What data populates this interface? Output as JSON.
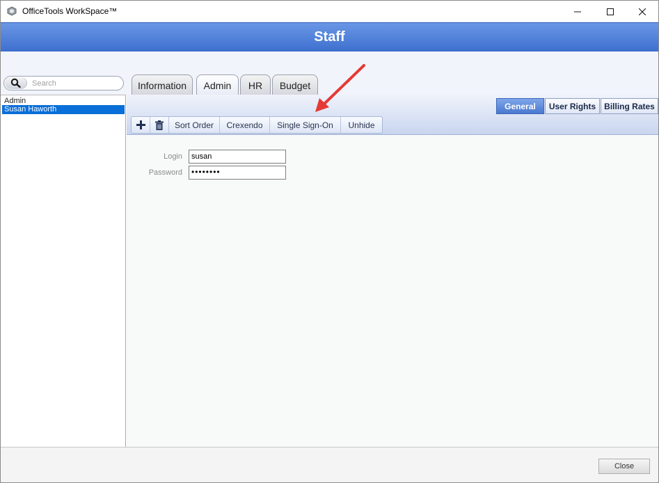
{
  "window": {
    "title": "OfficeTools WorkSpace™"
  },
  "header": {
    "title": "Staff"
  },
  "search": {
    "placeholder": "Search"
  },
  "staff_list": {
    "items": [
      "Admin",
      "Susan  Haworth"
    ],
    "selected": "Susan  Haworth"
  },
  "tabs": [
    {
      "label": "Information",
      "active": false
    },
    {
      "label": "Admin",
      "active": true
    },
    {
      "label": "HR",
      "active": false
    },
    {
      "label": "Budget",
      "active": false
    }
  ],
  "subtabs": [
    {
      "label": "General",
      "active": true
    },
    {
      "label": "User Rights",
      "active": false
    },
    {
      "label": "Billing Rates",
      "active": false
    }
  ],
  "toolbar": {
    "add_icon": "plus-icon",
    "delete_icon": "trash-icon",
    "buttons": [
      "Sort Order",
      "Crexendo",
      "Single Sign-On",
      "Unhide"
    ]
  },
  "form": {
    "login_label": "Login",
    "login_value": "susan",
    "password_label": "Password",
    "password_value": "••••••••"
  },
  "footer": {
    "close_label": "Close"
  },
  "colors": {
    "header_blue": "#3d6fce",
    "selection_blue": "#0a6fd8",
    "arrow_red": "#e53935"
  }
}
